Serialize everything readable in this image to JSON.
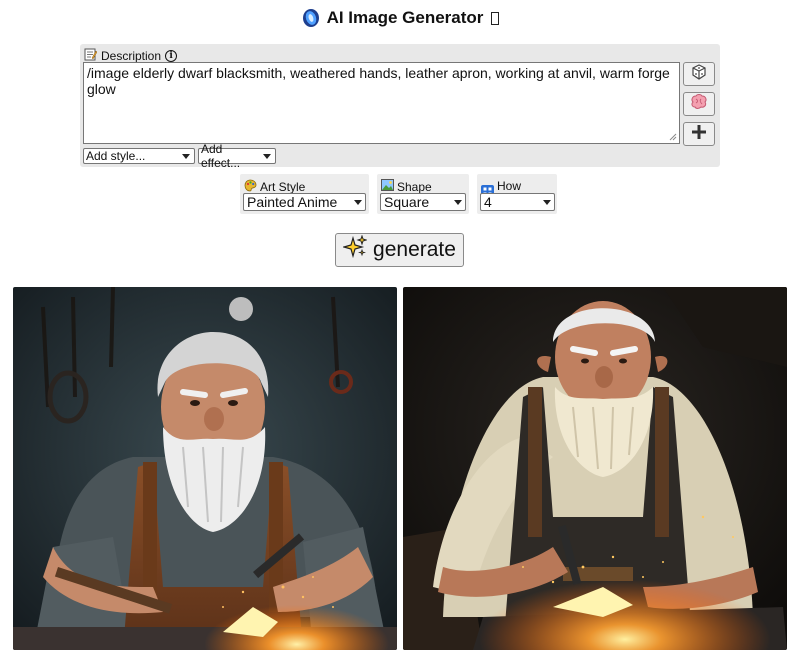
{
  "app": {
    "title": "AI Image Generator"
  },
  "description": {
    "label": "Description",
    "text": "/image elderly dwarf blacksmith, weathered hands, leather apron, working at anvil, warm forge glow"
  },
  "modifiers": {
    "style_select": "Add style...",
    "effect_select": "Add effect..."
  },
  "side_buttons": [
    {
      "icon": "dice-icon"
    },
    {
      "icon": "brain-icon"
    },
    {
      "icon": "plus-icon"
    }
  ],
  "options": {
    "art_style": {
      "label": "Art Style",
      "value": "Painted Anime",
      "icon": "palette-icon"
    },
    "shape": {
      "label": "Shape",
      "value": "Square",
      "icon": "picture-icon"
    },
    "count": {
      "label": "How many?",
      "value": "4",
      "icon": "grid-icon"
    }
  },
  "generate_button": {
    "label": "generate",
    "icon": "sparkles-icon"
  },
  "results": [
    {
      "subject": "dwarf-blacksmith-painting-1"
    },
    {
      "subject": "dwarf-blacksmith-painting-2"
    }
  ],
  "colors": {
    "panel_bg": "#e8e8e8",
    "accent_blue": "#2a6fd6",
    "forge_glow": "#ffb13b"
  }
}
